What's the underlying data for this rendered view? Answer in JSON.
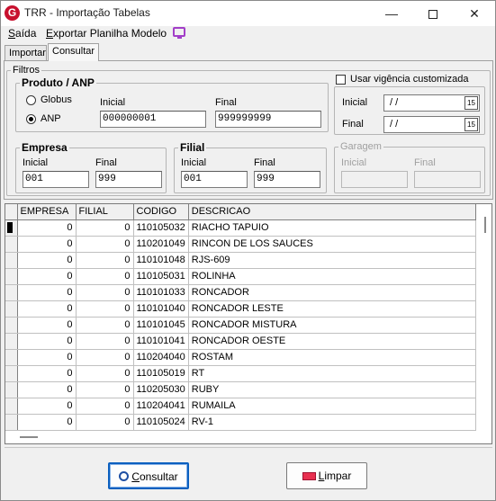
{
  "window": {
    "title": "TRR - Importação Tabelas",
    "logo_letter": "G",
    "min_glyph": "—",
    "close_glyph": "✕"
  },
  "menu": {
    "saida_first": "S",
    "saida_rest": "aída",
    "exportar_first": "E",
    "exportar_rest": "xportar Planilha Modelo"
  },
  "tabs": [
    "Importar",
    "Consultar"
  ],
  "filtros": {
    "title": "Filtros",
    "produto": {
      "title": "Produto / ANP",
      "options": [
        "Globus",
        "ANP"
      ],
      "selected": "ANP",
      "inicial_label": "Inicial",
      "final_label": "Final",
      "inicial": "000000001",
      "final": "999999999"
    },
    "vigencia": {
      "checkbox_label": "Usar vigência customizada",
      "checked": false,
      "inicial_label": "Inicial",
      "final_label": "Final",
      "inicial": "/ /",
      "final": "/ /",
      "cal_glyph": "15"
    },
    "empresa": {
      "title": "Empresa",
      "inicial_label": "Inicial",
      "final_label": "Final",
      "inicial": "001",
      "final": "999"
    },
    "filial": {
      "title": "Filial",
      "inicial_label": "Inicial",
      "final_label": "Final",
      "inicial": "001",
      "final": "999"
    },
    "garagem": {
      "title": "Garagem",
      "inicial_label": "Inicial",
      "final_label": "Final",
      "inicial": "",
      "final": ""
    }
  },
  "grid": {
    "columns": [
      "EMPRESA",
      "FILIAL",
      "CODIGO",
      "DESCRICAO"
    ],
    "rows": [
      [
        "0",
        "0",
        "110105032",
        "RIACHO TAPUIO"
      ],
      [
        "0",
        "0",
        "110201049",
        "RINCON DE LOS SAUCES"
      ],
      [
        "0",
        "0",
        "110101048",
        "RJS-609"
      ],
      [
        "0",
        "0",
        "110105031",
        "ROLINHA"
      ],
      [
        "0",
        "0",
        "110101033",
        "RONCADOR"
      ],
      [
        "0",
        "0",
        "110101040",
        "RONCADOR LESTE"
      ],
      [
        "0",
        "0",
        "110101045",
        "RONCADOR MISTURA"
      ],
      [
        "0",
        "0",
        "110101041",
        "RONCADOR OESTE"
      ],
      [
        "0",
        "0",
        "110204040",
        "ROSTAM"
      ],
      [
        "0",
        "0",
        "110105019",
        "RT"
      ],
      [
        "0",
        "0",
        "110205030",
        "RUBY"
      ],
      [
        "0",
        "0",
        "110204041",
        "RUMAILA"
      ],
      [
        "0",
        "0",
        "110105024",
        "RV-1"
      ]
    ]
  },
  "buttons": {
    "consultar_first": "C",
    "consultar_rest": "onsultar",
    "limpar_first": "L",
    "limpar_rest": "impar"
  }
}
